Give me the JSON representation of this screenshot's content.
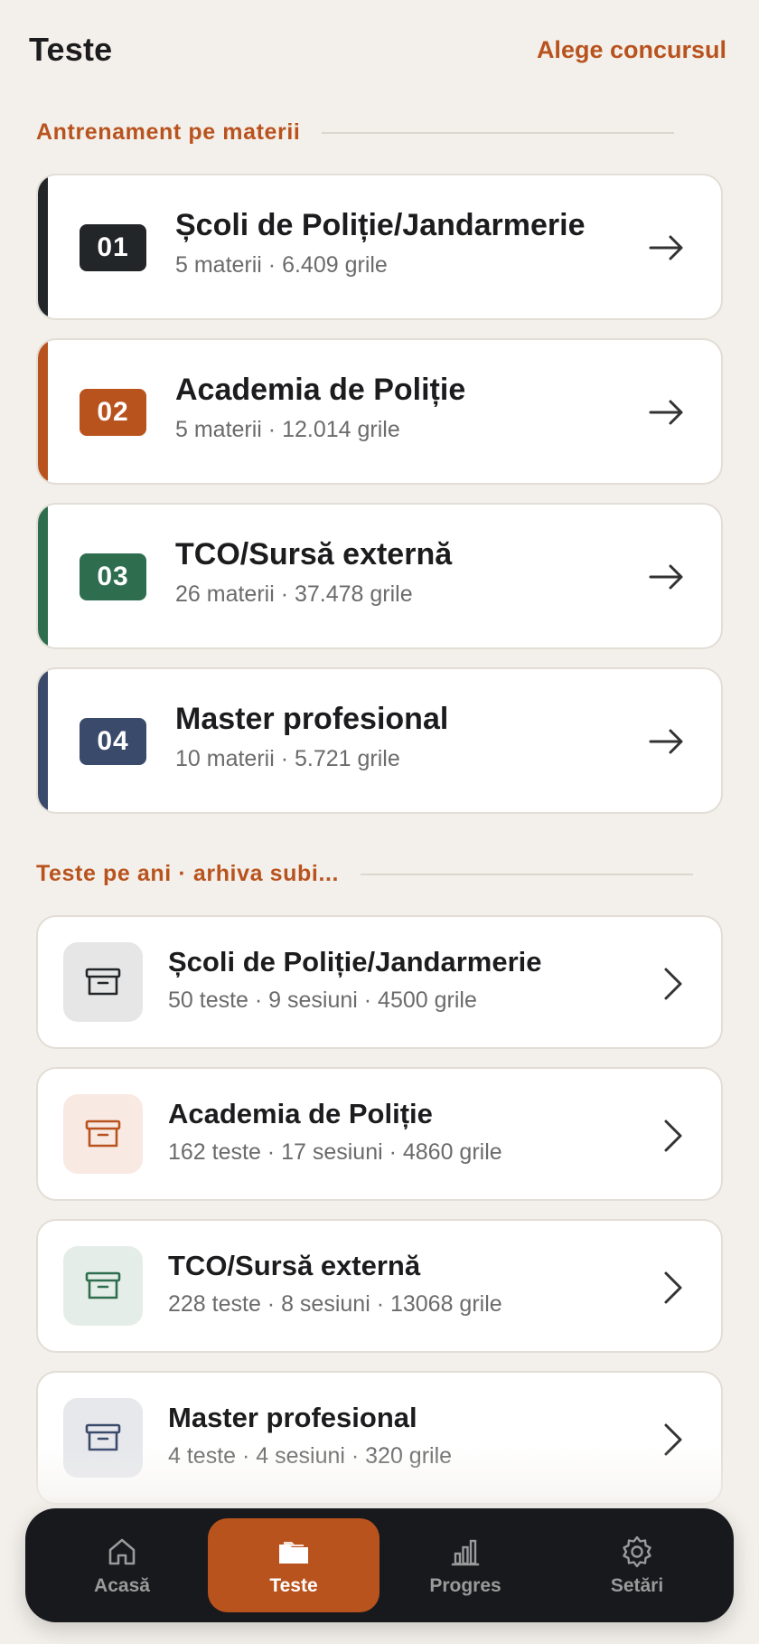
{
  "header": {
    "title": "Teste",
    "choose_label": "Alege concursul"
  },
  "training_section": {
    "label": "Antrenament pe materii",
    "cards": [
      {
        "num": "01",
        "name": "Școli de Poliție/Jandarmerie",
        "meta": "5 materii · 6.409 grile",
        "color": "#232628"
      },
      {
        "num": "02",
        "name": "Academia de Poliție",
        "meta": "5 materii · 12.014 grile",
        "color": "#b9531e"
      },
      {
        "num": "03",
        "name": "TCO/Sursă externă",
        "meta": "26 materii · 37.478 grile",
        "color": "#2e6e4e"
      },
      {
        "num": "04",
        "name": "Master profesional",
        "meta": "10 materii · 5.721 grile",
        "color": "#3a4a6b"
      }
    ]
  },
  "archive_section": {
    "label": "Teste pe ani · arhiva subi...",
    "cards": [
      {
        "name": "Școli de Poliție/Jandarmerie",
        "meta": "50 teste · 9 sesiuni · 4500 grile",
        "icon": "archive-box-icon",
        "icon_color": "#232628",
        "icon_bg": "#e6e6e6"
      },
      {
        "name": "Academia de Poliție",
        "meta": "162 teste · 17 sesiuni · 4860 grile",
        "icon": "archive-box-icon",
        "icon_color": "#b9531e",
        "icon_bg": "#f8e9e3"
      },
      {
        "name": "TCO/Sursă externă",
        "meta": "228 teste · 8 sesiuni · 13068 grile",
        "icon": "archive-box-icon",
        "icon_color": "#2e6e4e",
        "icon_bg": "#e5ede8"
      },
      {
        "name": "Master profesional",
        "meta": "4 teste · 4 sesiuni · 320 grile",
        "icon": "archive-box-icon",
        "icon_color": "#3a4a6b",
        "icon_bg": "#e6e8ec"
      }
    ]
  },
  "tabbar": {
    "tabs": [
      {
        "label": "Acasă",
        "icon": "home-icon"
      },
      {
        "label": "Teste",
        "icon": "folder-icon",
        "active": true
      },
      {
        "label": "Progres",
        "icon": "bar-chart-icon"
      },
      {
        "label": "Setări",
        "icon": "gear-icon"
      }
    ]
  },
  "colors": {
    "accent": "#b9531e",
    "background": "#f3f0eb",
    "tabbar": "#17191c"
  }
}
